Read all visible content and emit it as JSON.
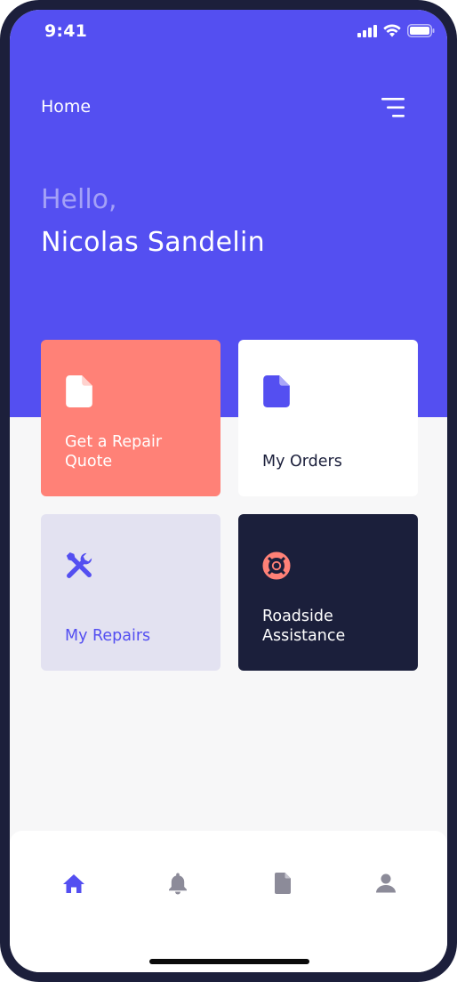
{
  "status": {
    "time": "9:41"
  },
  "header": {
    "title": "Home",
    "menu_icon": "hamburger-menu-icon"
  },
  "greeting": {
    "salutation": "Hello,",
    "name": "Nicolas Sandelin"
  },
  "tiles": [
    {
      "label": "Get a Repair Quote",
      "icon": "document-icon",
      "color": "#ff8177"
    },
    {
      "label": "My Orders",
      "icon": "document-icon",
      "color": "#ffffff"
    },
    {
      "label": "My Repairs",
      "icon": "tools-icon",
      "color": "#e3e2f1"
    },
    {
      "label": "Roadside Assistance",
      "icon": "lifebuoy-icon",
      "color": "#1b1f3b"
    }
  ],
  "tabbar": {
    "items": [
      {
        "icon": "home-icon",
        "active": true
      },
      {
        "icon": "bell-icon",
        "active": false
      },
      {
        "icon": "document-icon",
        "active": false
      },
      {
        "icon": "user-icon",
        "active": false
      }
    ]
  },
  "colors": {
    "brand": "#544ff1",
    "coral": "#ff8177",
    "navy": "#1b1f3b",
    "inactive": "#8c8b99"
  }
}
